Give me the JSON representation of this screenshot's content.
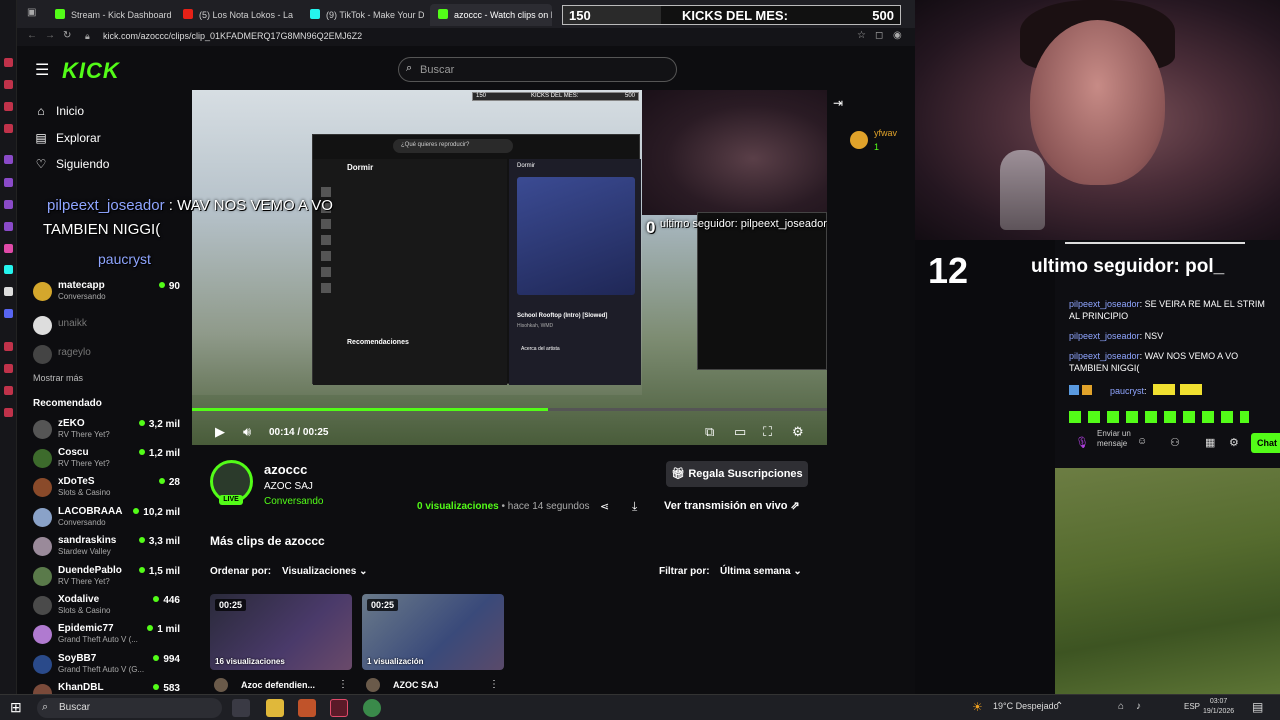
{
  "browser": {
    "tabs": [
      {
        "label": "Stream - Kick Dashboard",
        "color": "#53fc18"
      },
      {
        "label": "(5) Los Nota Lokos - La m",
        "color": "#e62117"
      },
      {
        "label": "(9) TikTok - Make Your Da",
        "color": "#25f4ee"
      },
      {
        "label": "azoccc - Watch clips on K",
        "color": "#53fc18"
      }
    ],
    "url": "kick.com/azoccc/clips/clip_01KFADMERQ17G8MN96Q2EMJ6Z2"
  },
  "kicks_bar": {
    "left": "150",
    "label": "KICKS DEL MES:",
    "right": "500"
  },
  "header": {
    "logo": "KICK",
    "search_placeholder": "Buscar"
  },
  "nav": {
    "items": [
      "Inicio",
      "Explorar",
      "Siguiendo"
    ]
  },
  "following": {
    "channels": [
      {
        "name": "matecapp",
        "game": "Conversando",
        "viewers": "90",
        "color": "#f0c419"
      },
      {
        "name": "unaikk",
        "game": "",
        "viewers": "",
        "color": "#666"
      },
      {
        "name": "rageylo",
        "game": "",
        "viewers": "",
        "color": "#555"
      }
    ],
    "show_more": "Mostrar más"
  },
  "recommended": {
    "title": "Recomendado",
    "channels": [
      {
        "name": "zEKO",
        "game": "RV There Yet?",
        "viewers": "3,2 mil",
        "color": "#6a6a6a"
      },
      {
        "name": "Coscu",
        "game": "RV There Yet?",
        "viewers": "1,2 mil",
        "color": "#3d6b2c"
      },
      {
        "name": "xDoTeS",
        "game": "Slots & Casino",
        "viewers": "28",
        "color": "#8a4a2a"
      },
      {
        "name": "LACOBRAAA",
        "game": "Conversando",
        "viewers": "10,2 mil",
        "color": "#8aa2c8"
      },
      {
        "name": "sandraskins",
        "game": "Stardew Valley",
        "viewers": "3,3 mil",
        "color": "#9a8a9a"
      },
      {
        "name": "DuendePablo",
        "game": "RV There Yet?",
        "viewers": "1,5 mil",
        "color": "#5a7a4a"
      },
      {
        "name": "Xodalive",
        "game": "Slots & Casino",
        "viewers": "446",
        "color": "#4a4a4a"
      },
      {
        "name": "Epidemic77",
        "game": "Grand Theft Auto V (...",
        "viewers": "1 mil",
        "color": "#b07ad0"
      },
      {
        "name": "SoyBB7",
        "game": "Grand Theft Auto V (G...",
        "viewers": "994",
        "color": "#2a4a8a"
      },
      {
        "name": "KhanDBL",
        "game": "",
        "viewers": "583",
        "color": "#7a4a3a"
      }
    ]
  },
  "video": {
    "time_current": "00:14",
    "time_sep": "/",
    "time_total": "00:25",
    "progress_fraction": 0.56,
    "inner_kicks_left": "150",
    "inner_kicks_label": "KICKS DEL MES:",
    "inner_kicks_right": "500",
    "spotify_playlist": "Dormir",
    "spotify_search": "¿Qué quieres reproducir?",
    "spotify_song": "School Rooftop (Intro) [Slowed]",
    "spotify_artist": "Hisohkah, WMD",
    "spotify_reco": "Recomendaciones",
    "spotify_about": "Acerca del artista",
    "overlay_msg_user": "pilpeext_joseador",
    "overlay_msg_text": ": WAV NOS VEMO A VO",
    "overlay_msg_text2": "TAMBIEN NIGGI(",
    "overlay_user2": "paucryst",
    "inner_zero": "0",
    "inner_follow": "ultimo seguidor: pilpeext_joseador"
  },
  "side_chat_peek": {
    "user": "yfwav",
    "count": "1"
  },
  "stream": {
    "channel": "azoccc",
    "title": "AZOC SAJ",
    "category": "Conversando",
    "live": "LIVE",
    "gift_label": "Regala Suscripciones",
    "views_count": "0",
    "views_label": "visualizaciones",
    "ago": "• hace 14 segundos",
    "watch_live": "Ver transmisión en vivo"
  },
  "clips": {
    "title": "Más clips de azoccc",
    "order_label": "Ordenar por:",
    "order_value": "Visualizaciones",
    "filter_label": "Filtrar por:",
    "filter_value": "Última semana",
    "items": [
      {
        "duration": "00:25",
        "views": "16 visualizaciones",
        "title": "Azoc defendien..."
      },
      {
        "duration": "00:25",
        "views": "1 visualización",
        "title": "AZOC SAJ"
      }
    ]
  },
  "overlay": {
    "count": "12",
    "follow": "ultimo seguidor: pol_",
    "chat": [
      {
        "user": "pilpeext_joseador",
        "text": ": SE VEIRA RE MAL EL STRIM AL PRINCIPIO"
      },
      {
        "user": "pilpeext_joseador",
        "text": ": NSV"
      },
      {
        "user": "pilpeext_joseador",
        "text": ": WAV NOS VEMO A VO TAMBIEN NIGGI("
      },
      {
        "user": "paucryst",
        "text": ":"
      }
    ],
    "input_placeholder": "Enviar un mensaje",
    "chat_button": "Chat"
  },
  "taskbar": {
    "search": "Buscar",
    "weather": "19°C  Despejado",
    "lang": "ESP",
    "time": "03:07",
    "date": "19/1/2026"
  },
  "colors": {
    "kick_green": "#53fc18",
    "username_blue": "#8fa5ff"
  }
}
